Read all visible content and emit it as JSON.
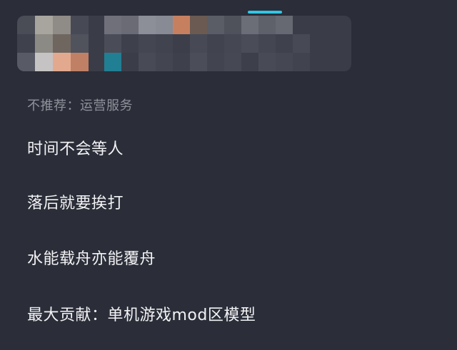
{
  "colors": {
    "background": "#2b2d38",
    "card": "#3a3d48",
    "accent": "#2fc7e6",
    "primary_text": "#f2f3f5",
    "secondary_text": "#8f919b"
  },
  "recommend_reason": "不推荐：运营服务",
  "items": [
    {
      "label": "时间不会等人"
    },
    {
      "label": "落后就要挨打"
    },
    {
      "label": "水能载舟亦能覆舟"
    },
    {
      "label": "最大贡献：单机游戏mod区模型"
    }
  ]
}
